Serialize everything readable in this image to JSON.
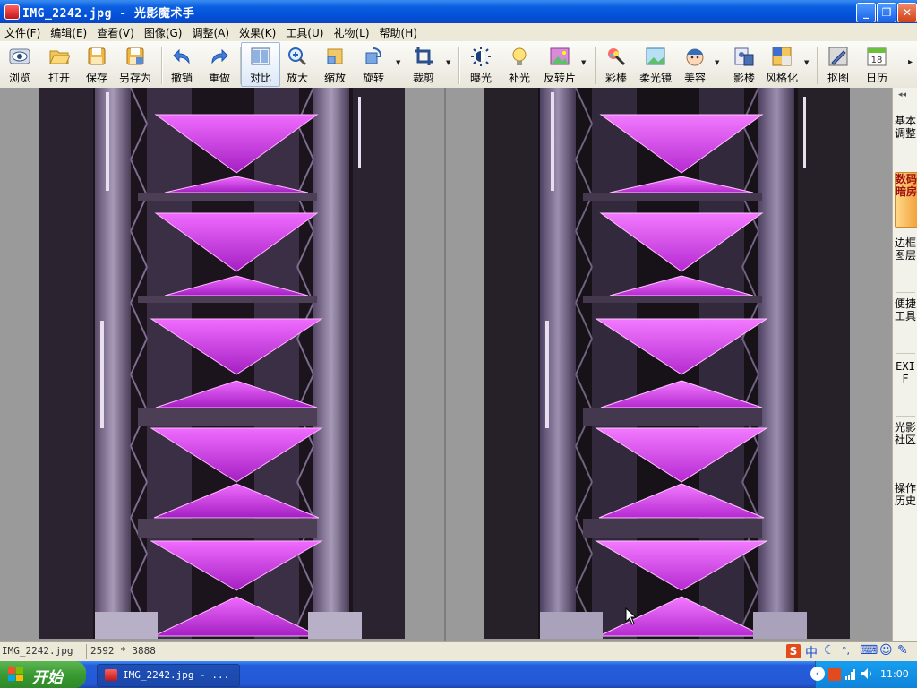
{
  "window": {
    "title": "IMG_2242.jpg - 光影魔术手",
    "min_label": "_",
    "max_label": "❐",
    "close_label": "✕"
  },
  "menu": [
    {
      "id": "file",
      "label": "文件(F)"
    },
    {
      "id": "edit",
      "label": "编辑(E)"
    },
    {
      "id": "view",
      "label": "查看(V)"
    },
    {
      "id": "image",
      "label": "图像(G)"
    },
    {
      "id": "adjust",
      "label": "调整(A)"
    },
    {
      "id": "effects",
      "label": "效果(K)"
    },
    {
      "id": "tools",
      "label": "工具(U)"
    },
    {
      "id": "gifts",
      "label": "礼物(L)"
    },
    {
      "id": "help",
      "label": "帮助(H)"
    }
  ],
  "toolbar": {
    "browse": "浏览",
    "open": "打开",
    "save": "保存",
    "save_as": "另存为",
    "undo": "撤销",
    "redo": "重做",
    "compare": "对比",
    "zoom": "放大",
    "resize": "缩放",
    "rotate": "旋转",
    "crop": "裁剪",
    "exposure": "曝光",
    "fill_light": "补光",
    "negative": "反转片",
    "color_stick": "彩棒",
    "soft_focus": "柔光镜",
    "beauty": "美容",
    "studio": "影楼",
    "style": "风格化",
    "cutout": "抠图",
    "calendar": "日历",
    "calendar_day": "18",
    "more": "▸"
  },
  "toolbar_icons": {
    "browse": "eye-icon",
    "open": "folder-open-icon",
    "save": "floppy-disk-icon",
    "save_as": "floppy-save-as-icon",
    "undo": "undo-arrow-icon",
    "redo": "redo-arrow-icon",
    "compare": "compare-split-icon",
    "zoom": "magnifier-plus-icon",
    "resize": "resize-icon",
    "rotate": "rotate-icon",
    "crop": "crop-icon",
    "exposure": "sun-icon",
    "fill_light": "bulb-icon",
    "negative": "negative-film-icon",
    "color_stick": "color-wand-icon",
    "soft_focus": "soft-lens-icon",
    "beauty": "face-icon",
    "studio": "portrait-studio-icon",
    "style": "style-palette-icon",
    "cutout": "cutout-pen-icon",
    "calendar": "calendar-icon"
  },
  "right_panel": {
    "collapse": "◂◂",
    "tabs": [
      {
        "id": "basic",
        "label": "基本调整",
        "active": false
      },
      {
        "id": "darkroom",
        "label": "数码暗房",
        "active": true
      },
      {
        "id": "frames",
        "label": "边框图层",
        "active": false
      },
      {
        "id": "quick",
        "label": "便捷工具",
        "active": false
      },
      {
        "id": "exif",
        "label": "EXIF",
        "active": false
      },
      {
        "id": "community",
        "label": "光影社区",
        "active": false
      },
      {
        "id": "history",
        "label": "操作历史",
        "active": false
      }
    ]
  },
  "status": {
    "filename": "IMG_2242.jpg",
    "dimensions": "2592 * 3888"
  },
  "ime": {
    "logo": "S",
    "lang": "中",
    "moon": "☾",
    "punct": "°,",
    "keyboard": "⌨",
    "user": "☺",
    "wrench": "✎"
  },
  "taskbar": {
    "start_label": "开始",
    "task_label": "IMG_2242.jpg - ...",
    "clock": "11:00"
  },
  "colors": {
    "titlebar_blue": "#0350d8",
    "start_green": "#3a9a32",
    "photo_magenta": "#d23fe8",
    "active_tab_orange": "#f2a33c"
  }
}
